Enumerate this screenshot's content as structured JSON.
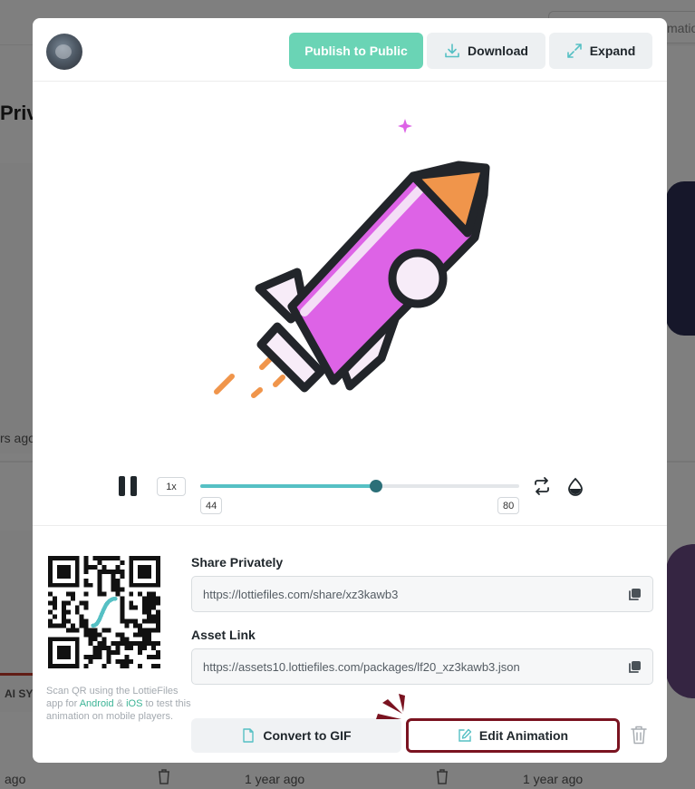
{
  "background": {
    "heading_partial": "Priv",
    "left_time_partial": "rs ago",
    "left_label_partial": "AI SYS",
    "bottom_left_partial": "ago",
    "bottom_mid_time": "1 year ago",
    "bottom_right_time": "1 year ago",
    "header_pill_partial": "mation"
  },
  "modal": {
    "header": {
      "publish_label": "Publish to Public",
      "download_label": "Download",
      "expand_label": "Expand"
    },
    "player": {
      "speed": "1x",
      "progress": 0.55,
      "current_frame": "44",
      "end_frame": "80"
    },
    "share": {
      "share_privately_label": "Share Privately",
      "share_privately_url": "https://lottiefiles.com/share/xz3kawb3",
      "asset_link_label": "Asset Link",
      "asset_link_url": "https://assets10.lottiefiles.com/packages/lf20_xz3kawb3.json",
      "qr_caption_pre": "Scan QR using the LottieFiles app for ",
      "android_link": "Android",
      "qr_caption_amp": " & ",
      "ios_link": "iOS",
      "qr_caption_post": " to test this animation on mobile players.",
      "convert_gif_label": "Convert to GIF",
      "edit_animation_label": "Edit Animation"
    }
  },
  "icons": {
    "download": "download-icon",
    "expand": "expand-icon",
    "pause": "pause-icon",
    "loop": "loop-icon",
    "background": "background-color-icon",
    "copy": "copy-icon",
    "file": "file-icon",
    "edit": "edit-icon",
    "trash": "trash-icon"
  },
  "colors": {
    "accent": "#6ad4b5",
    "progress": "#56c0c4",
    "highlight_border": "#7a1320",
    "rocket_body": "#dd63e6",
    "rocket_tip": "#f0954b",
    "rocket_outline": "#22252a"
  }
}
